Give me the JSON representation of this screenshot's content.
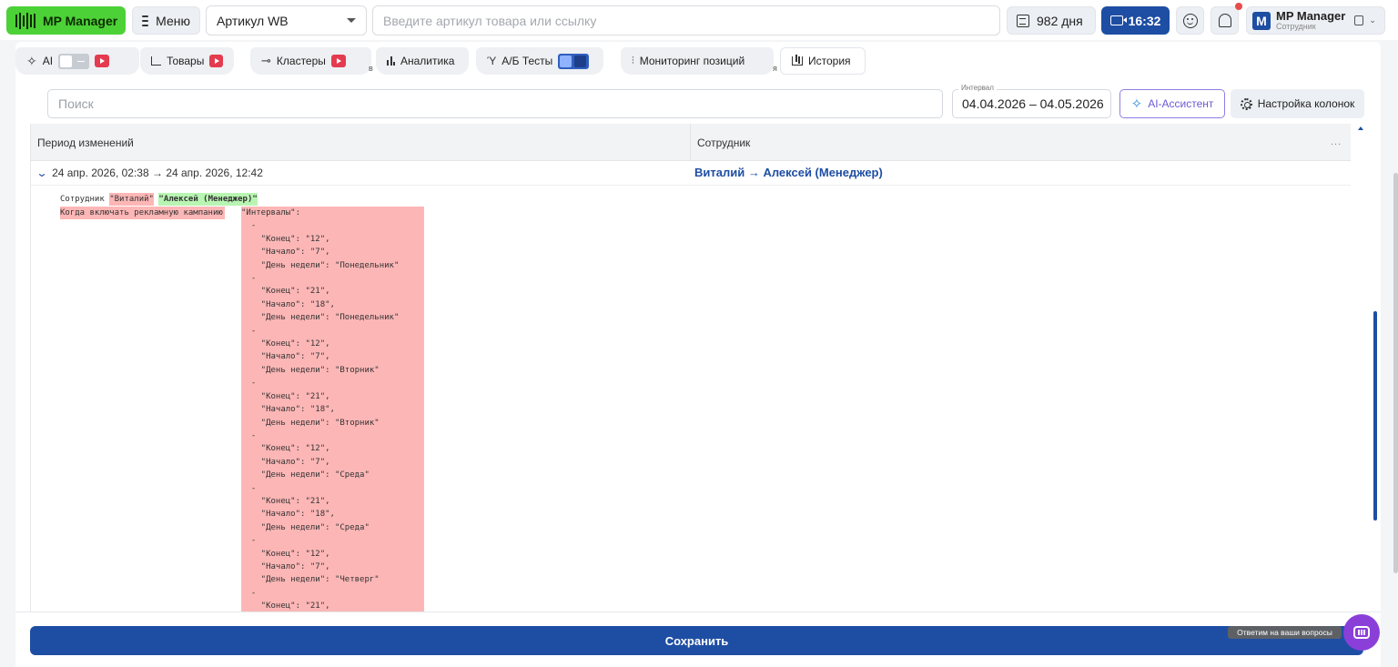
{
  "topbar": {
    "logo_label": "MP Manager",
    "menu_label": "Меню",
    "article_select": "Артикул WB",
    "search_placeholder": "Введите артикул товара или ссылку",
    "days_label": "982 дня",
    "time_label": "16:32",
    "account_name": "MP Manager",
    "account_role": "Сотрудник",
    "account_initial": "M"
  },
  "tabs": [
    {
      "label": "AI",
      "icon": "sparkle-icon"
    },
    {
      "label": "Товары",
      "icon": "chart-line-icon"
    },
    {
      "label": "Кластеры",
      "icon": "key-icon"
    },
    {
      "label": "Аналитика",
      "icon": "bar-chart-icon"
    },
    {
      "label": "А/Б Тесты",
      "icon": "fork-icon"
    },
    {
      "label": "Мониторинг позиций",
      "icon": "sliders-icon"
    },
    {
      "label": "История",
      "icon": "history-icon"
    }
  ],
  "tab_fragments": [
    "в",
    "я"
  ],
  "filters": {
    "search_placeholder": "Поиск",
    "interval_label": "Интервал",
    "interval_value": "04.04.2026 – 04.05.2026",
    "ai_assistant": "AI-Ассистент",
    "columns_settings": "Настройка колонок"
  },
  "table": {
    "columns": [
      "Период изменений",
      "Сотрудник"
    ],
    "more": "...",
    "row": {
      "period": "24 апр. 2026, 02:38 → 24 апр. 2026, 12:42",
      "employee": "Виталий → Алексей (Менеджер)"
    },
    "diff": {
      "field1": "Сотрудник",
      "old1": "\"Виталий\"",
      "new1": "\"Алексей (Менеджер)\"",
      "field2": "Когда включать рекламную кампанию",
      "block": "\"Интервалы\":\n  -\n    \"Конец\": \"12\",\n    \"Начало\": \"7\",\n    \"День недели\": \"Понедельник\"\n  -\n    \"Конец\": \"21\",\n    \"Начало\": \"18\",\n    \"День недели\": \"Понедельник\"\n  -\n    \"Конец\": \"12\",\n    \"Начало\": \"7\",\n    \"День недели\": \"Вторник\"\n  -\n    \"Конец\": \"21\",\n    \"Начало\": \"18\",\n    \"День недели\": \"Вторник\"\n  -\n    \"Конец\": \"12\",\n    \"Начало\": \"7\",\n    \"День недели\": \"Среда\"\n  -\n    \"Конец\": \"21\",\n    \"Начало\": \"18\",\n    \"День недели\": \"Среда\"\n  -\n    \"Конец\": \"12\",\n    \"Начало\": \"7\",\n    \"День недели\": \"Четверг\"\n  -\n    \"Конец\": \"21\","
    }
  },
  "footer": {
    "save_label": "Сохранить",
    "help_tooltip": "Ответим на ваши вопросы"
  },
  "colors": {
    "brand_green": "#4cd137",
    "primary_blue": "#1e4ea3",
    "diff_removed": "#fdb6b6",
    "diff_added": "#b9f5b2",
    "ai_purple": "#8f7de4",
    "chat_purple": "#8a3fd9"
  }
}
